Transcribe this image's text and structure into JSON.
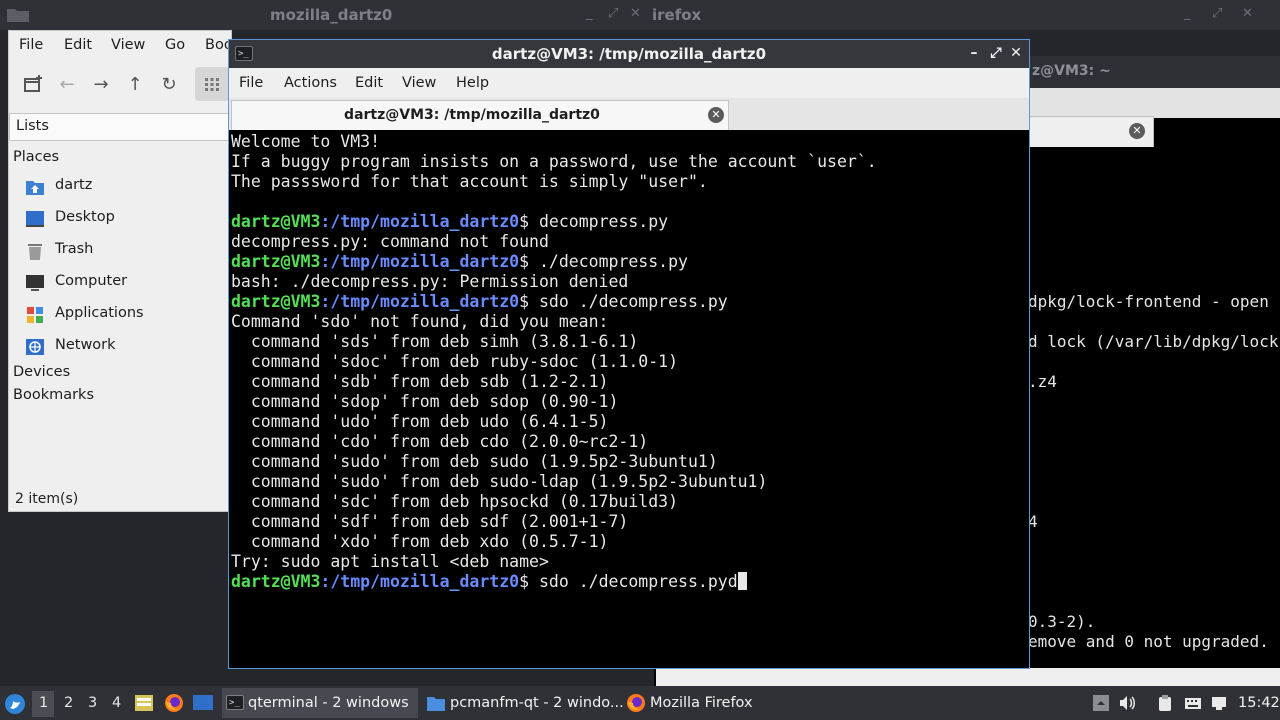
{
  "bg_titlebar": {
    "left_title": "mozilla_dartz0",
    "right_title": "irefox",
    "controls": [
      "_",
      "⤢",
      "✕"
    ]
  },
  "file_manager": {
    "menu": [
      "File",
      "Edit",
      "View",
      "Go",
      "Boo"
    ],
    "panel_label": "Lists",
    "sections": {
      "places": "Places",
      "devices": "Devices",
      "bookmarks": "Bookmarks"
    },
    "places": [
      {
        "label": "dartz",
        "icon": "home-folder-icon"
      },
      {
        "label": "Desktop",
        "icon": "desktop-icon"
      },
      {
        "label": "Trash",
        "icon": "trash-icon"
      },
      {
        "label": "Computer",
        "icon": "computer-icon"
      },
      {
        "label": "Applications",
        "icon": "applications-icon"
      },
      {
        "label": "Network",
        "icon": "network-icon"
      }
    ],
    "status": "2 item(s)"
  },
  "bg_terminal": {
    "title": "z@VM3: ~",
    "lines": [
      {
        "text": "dpkg/lock-frontend - open"
      },
      {
        "text": "d lock (/var/lib/dpkg/lock"
      },
      {
        "text": ".z4"
      },
      {
        "text": "4"
      },
      {
        "text": "0.3-2)."
      },
      {
        "text": "emove and 0 not upgraded."
      }
    ]
  },
  "terminal": {
    "title": "dartz@VM3: /tmp/mozilla_dartz0",
    "menu": [
      "File",
      "Actions",
      "Edit",
      "View",
      "Help"
    ],
    "tab_label": "dartz@VM3: /tmp/mozilla_dartz0",
    "prompt_user": "dartz@VM3",
    "prompt_path": ":/tmp/mozilla_dartz0",
    "prompt_end": "$ ",
    "lines": [
      {
        "prompt": false,
        "text": "Welcome to VM3!"
      },
      {
        "prompt": false,
        "text": "If a buggy program insists on a password, use the account `user`."
      },
      {
        "prompt": false,
        "text": "The passsword for that account is simply \"user\"."
      },
      {
        "prompt": false,
        "text": ""
      },
      {
        "prompt": true,
        "text": "decompress.py"
      },
      {
        "prompt": false,
        "text": "decompress.py: command not found"
      },
      {
        "prompt": true,
        "text": "./decompress.py"
      },
      {
        "prompt": false,
        "text": "bash: ./decompress.py: Permission denied"
      },
      {
        "prompt": true,
        "text": "sdo ./decompress.py"
      },
      {
        "prompt": false,
        "text": "Command 'sdo' not found, did you mean:"
      },
      {
        "prompt": false,
        "text": "  command 'sds' from deb simh (3.8.1-6.1)"
      },
      {
        "prompt": false,
        "text": "  command 'sdoc' from deb ruby-sdoc (1.1.0-1)"
      },
      {
        "prompt": false,
        "text": "  command 'sdb' from deb sdb (1.2-2.1)"
      },
      {
        "prompt": false,
        "text": "  command 'sdop' from deb sdop (0.90-1)"
      },
      {
        "prompt": false,
        "text": "  command 'udo' from deb udo (6.4.1-5)"
      },
      {
        "prompt": false,
        "text": "  command 'cdo' from deb cdo (2.0.0~rc2-1)"
      },
      {
        "prompt": false,
        "text": "  command 'sudo' from deb sudo (1.9.5p2-3ubuntu1)"
      },
      {
        "prompt": false,
        "text": "  command 'sudo' from deb sudo-ldap (1.9.5p2-3ubuntu1)"
      },
      {
        "prompt": false,
        "text": "  command 'sdc' from deb hpsockd (0.17build3)"
      },
      {
        "prompt": false,
        "text": "  command 'sdf' from deb sdf (2.001+1-7)"
      },
      {
        "prompt": false,
        "text": "  command 'xdo' from deb xdo (0.5.7-1)"
      },
      {
        "prompt": false,
        "text": "Try: sudo apt install <deb name>"
      },
      {
        "prompt": true,
        "text": "sdo ./decompress.pyd",
        "cursor": true
      }
    ]
  },
  "taskbar": {
    "workspaces": [
      "1",
      "2",
      "3",
      "4"
    ],
    "active_workspace": "1",
    "tasks": [
      {
        "label": "qterminal - 2 windows",
        "icon": "terminal-icon"
      },
      {
        "label": "pcmanfm-qt - 2 windo...",
        "icon": "folder-icon"
      },
      {
        "label": "Mozilla Firefox",
        "icon": "firefox-icon"
      }
    ],
    "clock": "15:42"
  },
  "colors": {
    "prompt_user": "#54e054",
    "prompt_path": "#6b8cff",
    "window_border_active": "#5a9ad8"
  }
}
